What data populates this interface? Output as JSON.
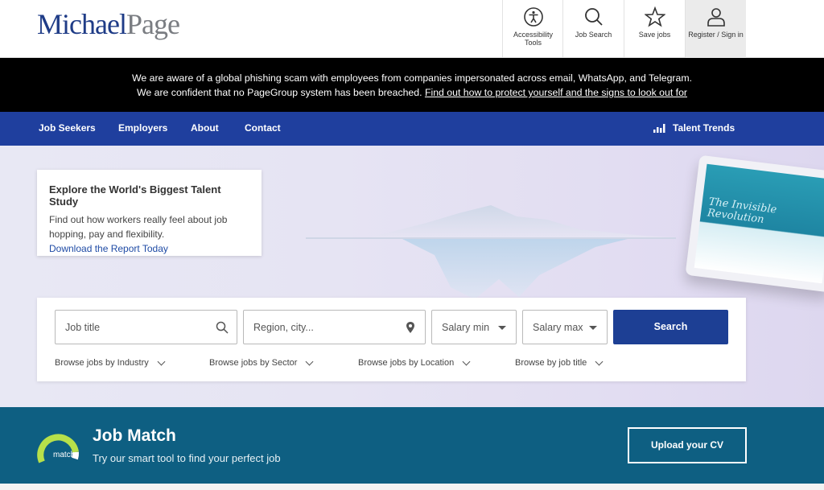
{
  "brand": {
    "logo_part1": "Michael",
    "logo_part2": "Page",
    "blue": "#1f3c87",
    "grey": "#7a7d82"
  },
  "utility": {
    "accessibility": "Accessibility Tools",
    "job_search": "Job Search",
    "save_jobs": "Save jobs",
    "register": "Register / Sign in"
  },
  "alert": {
    "line1": "We are aware of a global phishing scam with employees from companies impersonated across email, WhatsApp, and Telegram.",
    "line2": "We are confident that no PageGroup system has been breached.",
    "link": "Find out how to protect yourself and the signs to look out for"
  },
  "nav": {
    "job_seekers": "Job Seekers",
    "employers": "Employers",
    "about": "About",
    "contact": "Contact",
    "talent_trends": "Talent Trends",
    "bg": "#1f3f9e"
  },
  "hero_card": {
    "title": "Explore the World's Biggest Talent Study",
    "body": "Find out how workers really feel about job hopping, pay and flexibility.",
    "link": "Download the Report Today"
  },
  "tablet": {
    "title": "The Invisible Revolution"
  },
  "search": {
    "job_title_placeholder": "Job title",
    "region_placeholder": "Region, city...",
    "salary_min": "Salary min",
    "salary_max": "Salary max",
    "button": "Search"
  },
  "browse": {
    "industry": "Browse jobs by Industry",
    "sector": "Browse jobs by Sector",
    "location": "Browse jobs by Location",
    "job_title": "Browse by job title"
  },
  "job_match": {
    "badge": "match",
    "title": "Job Match",
    "subtitle": "Try our smart tool to find your perfect job",
    "button": "Upload your CV",
    "bg": "#0e5f82"
  }
}
